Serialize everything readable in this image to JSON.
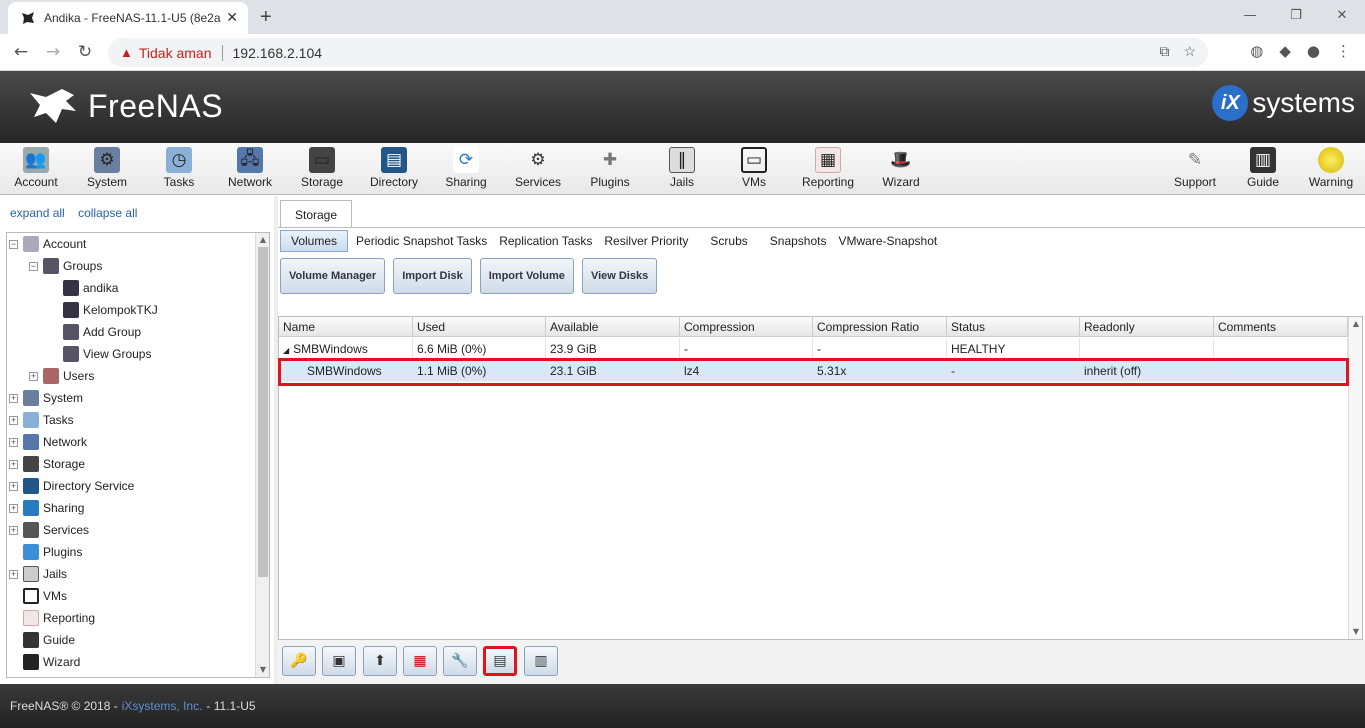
{
  "browser": {
    "tab_title": "Andika - FreeNAS-11.1-U5 (8e2a",
    "security_label": "Tidak aman",
    "url": "192.168.2.104"
  },
  "header": {
    "logo_text": "FreeNAS",
    "brand_right": "systems",
    "brand_badge": "iX"
  },
  "toolbar": {
    "items": [
      {
        "label": "Account",
        "icon": "account-icon"
      },
      {
        "label": "System",
        "icon": "system-icon"
      },
      {
        "label": "Tasks",
        "icon": "tasks-icon"
      },
      {
        "label": "Network",
        "icon": "network-icon"
      },
      {
        "label": "Storage",
        "icon": "storage-icon"
      },
      {
        "label": "Directory",
        "icon": "directory-icon"
      },
      {
        "label": "Sharing",
        "icon": "sharing-icon"
      },
      {
        "label": "Services",
        "icon": "services-icon"
      },
      {
        "label": "Plugins",
        "icon": "plugins-icon"
      },
      {
        "label": "Jails",
        "icon": "jails-icon"
      },
      {
        "label": "VMs",
        "icon": "vms-icon"
      },
      {
        "label": "Reporting",
        "icon": "reporting-icon"
      },
      {
        "label": "Wizard",
        "icon": "wizard-icon"
      }
    ],
    "right_items": [
      {
        "label": "Support",
        "icon": "support-icon"
      },
      {
        "label": "Guide",
        "icon": "guide-icon"
      },
      {
        "label": "Warning",
        "icon": "warning-icon"
      }
    ]
  },
  "sidebar": {
    "expand_all": "expand all",
    "collapse_all": "collapse all",
    "tree": [
      {
        "label": "Account",
        "toggle": "−"
      },
      {
        "label": "Groups",
        "toggle": "−"
      },
      {
        "label": "andika",
        "toggle": ""
      },
      {
        "label": "KelompokTKJ",
        "toggle": ""
      },
      {
        "label": "Add Group",
        "toggle": ""
      },
      {
        "label": "View Groups",
        "toggle": ""
      },
      {
        "label": "Users",
        "toggle": "+"
      },
      {
        "label": "System",
        "toggle": "+"
      },
      {
        "label": "Tasks",
        "toggle": "+"
      },
      {
        "label": "Network",
        "toggle": "+"
      },
      {
        "label": "Storage",
        "toggle": "+"
      },
      {
        "label": "Directory Service",
        "toggle": "+"
      },
      {
        "label": "Sharing",
        "toggle": "+"
      },
      {
        "label": "Services",
        "toggle": "+"
      },
      {
        "label": "Plugins",
        "toggle": ""
      },
      {
        "label": "Jails",
        "toggle": "+"
      },
      {
        "label": "VMs",
        "toggle": ""
      },
      {
        "label": "Reporting",
        "toggle": ""
      },
      {
        "label": "Guide",
        "toggle": ""
      },
      {
        "label": "Wizard",
        "toggle": ""
      }
    ]
  },
  "main": {
    "tab": "Storage",
    "subtabs": [
      "Volumes",
      "Periodic Snapshot Tasks",
      "Replication Tasks",
      "Resilver Priority",
      "Scrubs",
      "Snapshots",
      "VMware-Snapshot"
    ],
    "actions": [
      "Volume Manager",
      "Import Disk",
      "Import Volume",
      "View Disks"
    ],
    "columns": [
      "Name",
      "Used",
      "Available",
      "Compression",
      "Compression Ratio",
      "Status",
      "Readonly",
      "Comments"
    ],
    "rows": [
      {
        "name": "SMBWindows",
        "used": "6.6 MiB (0%)",
        "available": "23.9 GiB",
        "compression": "-",
        "ratio": "-",
        "status": "HEALTHY",
        "readonly": "",
        "comments": ""
      },
      {
        "name": "SMBWindows",
        "used": "1.1 MiB (0%)",
        "available": "23.1 GiB",
        "compression": "lz4",
        "ratio": "5.31x",
        "status": "-",
        "readonly": "inherit (off)",
        "comments": ""
      }
    ],
    "bottom_buttons": [
      {
        "icon": "key-icon"
      },
      {
        "icon": "add-dataset-icon"
      },
      {
        "icon": "upload-icon"
      },
      {
        "icon": "delete-volume-icon"
      },
      {
        "icon": "wrench-icon"
      },
      {
        "icon": "create-zvol-icon"
      },
      {
        "icon": "volume-status-icon"
      }
    ]
  },
  "footer": {
    "prefix": "FreeNAS® © 2018 -",
    "link": "iXsystems, Inc.",
    "suffix": "- 11.1-U5"
  }
}
